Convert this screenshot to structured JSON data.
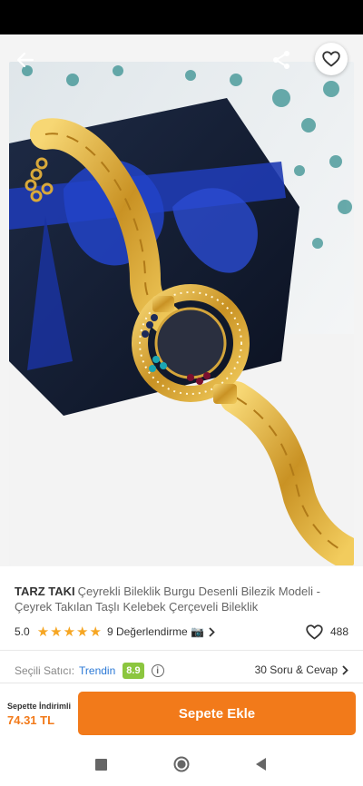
{
  "product": {
    "brand": "TARZ TAKI",
    "title": "Çeyrekli Bileklik Burgu Desenli Bilezik Modeli - Çeyrek Takılan Taşlı Kelebek Çerçeveli Bileklik",
    "rating": "5.0",
    "star_count": 5,
    "review_link": "9 Değerlendirme 📷",
    "favorite_count": "488"
  },
  "gallery": {
    "image_count": 3,
    "active_index": 0
  },
  "seller": {
    "label": "Seçili Satıcı:",
    "name": "Trendin",
    "score": "8.9",
    "qa_link": "30 Soru & Cevap"
  },
  "cart": {
    "price_label": "Sepette İndirimli",
    "price": "74.31 TL",
    "add_button": "Sepete Ekle"
  },
  "icons": {
    "back": "arrow-left",
    "share": "share",
    "favorite": "heart-outline",
    "info": "info-circle",
    "chevron": "chevron-right",
    "nav_recents": "square",
    "nav_home": "circle",
    "nav_back": "triangle-left"
  },
  "colors": {
    "accent": "#f27a1a",
    "seller_link": "#2b79d6",
    "seller_score_bg": "#8cc63f",
    "star": "#f6a623"
  }
}
